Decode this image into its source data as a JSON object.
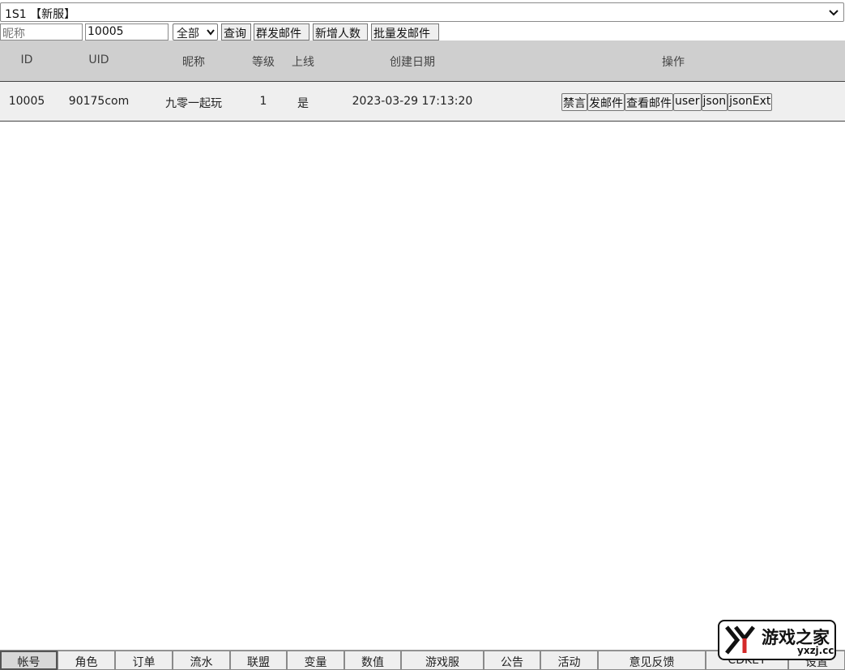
{
  "server_select": {
    "value": "1S1 【新服】"
  },
  "toolbar": {
    "nickname_placeholder": "昵称",
    "uid_value": "10005",
    "filter_value": "全部",
    "buttons": [
      "查询",
      "群发邮件",
      "新增人数",
      "批量发邮件"
    ]
  },
  "table": {
    "headers": [
      "ID",
      "UID",
      "昵称",
      "等级",
      "上线",
      "创建日期",
      "操作"
    ],
    "rows": [
      {
        "id": "10005",
        "uid": "90175com",
        "nickname": "九零一起玩",
        "level": "1",
        "online": "是",
        "created": "2023-03-29 17:13:20",
        "actions": [
          "禁言",
          "发邮件",
          "查看邮件",
          "user",
          "json",
          "jsonExt"
        ]
      }
    ]
  },
  "bottom_tabs": [
    "帐号",
    "角色",
    "订单",
    "流水",
    "联盟",
    "变量",
    "数值",
    "游戏服",
    "公告",
    "活动",
    "意见反馈",
    "CDKEY",
    "设置"
  ],
  "active_tab_index": 0,
  "watermark": {
    "cn": "游戏之家",
    "en": "yxzj.cc"
  }
}
